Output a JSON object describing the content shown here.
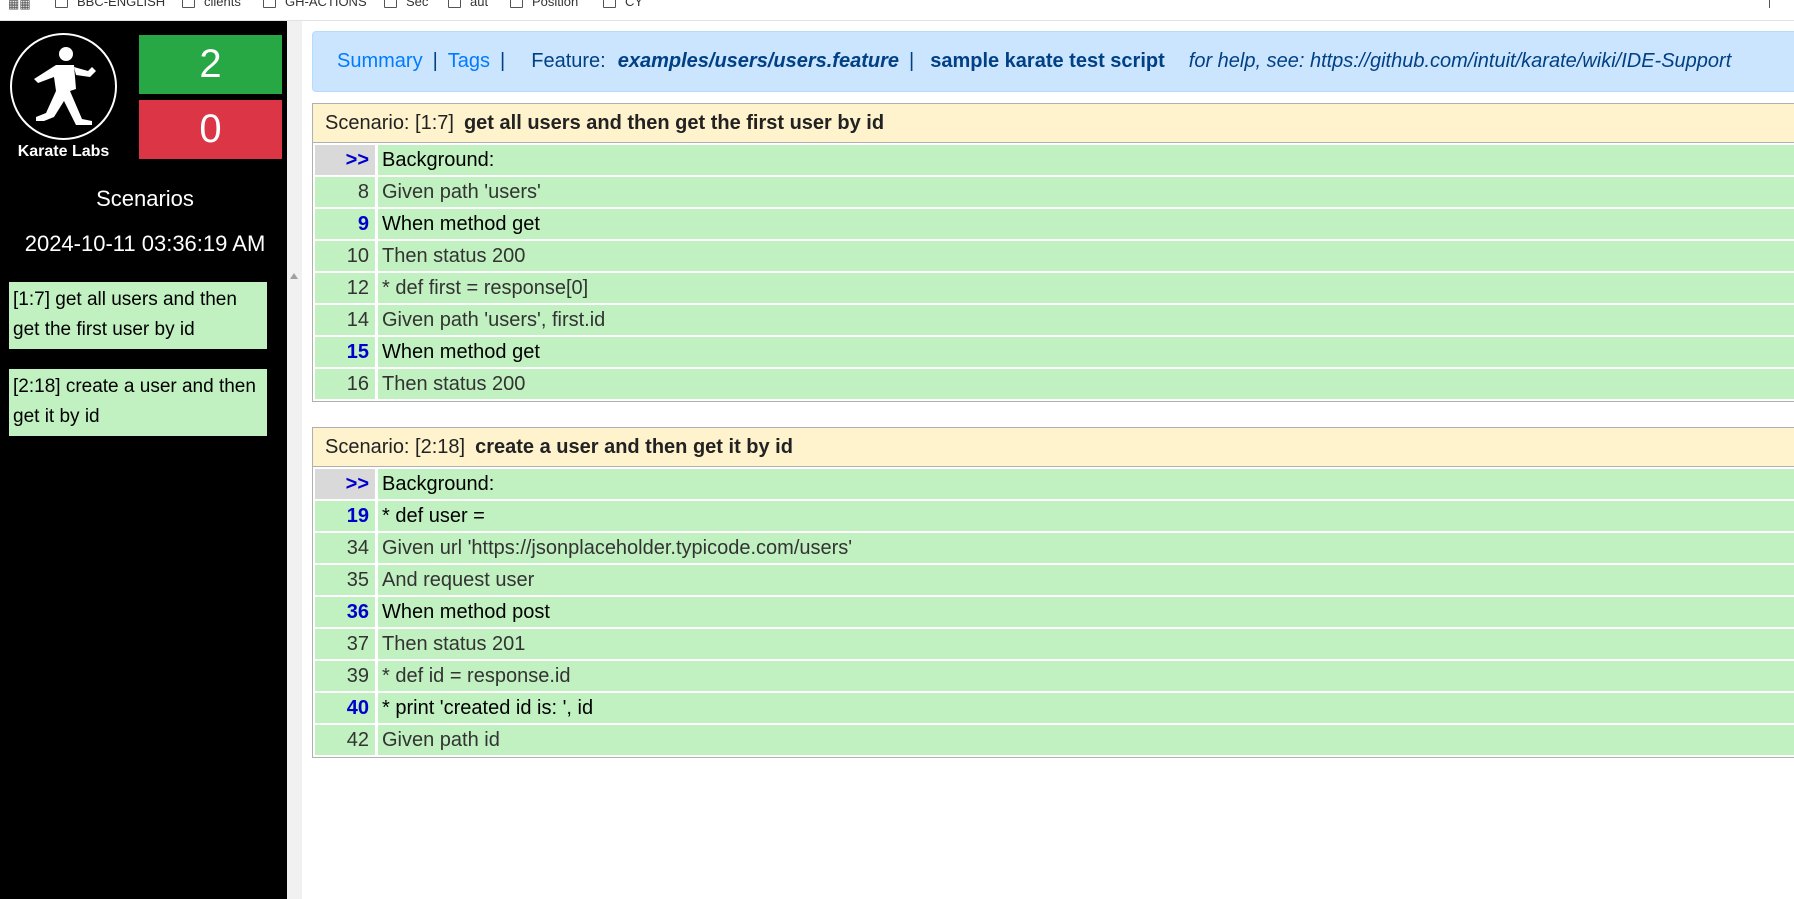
{
  "bookmarks": {
    "items": [
      "BBC-ENGLISH",
      "clients",
      "GH-ACTIONS",
      "Sec",
      "aut",
      "Position",
      "CY"
    ]
  },
  "sidebar": {
    "logo_text": "Karate Labs",
    "passed": "2",
    "failed": "0",
    "title": "Scenarios",
    "timestamp": "2024-10-11 03:36:19 AM",
    "scenarios": [
      "[1:7] get all users and then get the first user by id",
      "[2:18] create a user and then get it by id"
    ]
  },
  "header": {
    "summary": "Summary",
    "tags": "Tags",
    "sep": "|",
    "feature_label": "Feature:",
    "feature_path": "examples/users/users.feature",
    "feature_desc": "sample karate test script",
    "help": "for help, see: https://github.com/intuit/karate/wiki/IDE-Support"
  },
  "scenarios": [
    {
      "ref": "Scenario: [1:7]",
      "name": "get all users and then get the first user by id",
      "steps": [
        {
          "line": ">>",
          "text": "Background:",
          "kind": "bg"
        },
        {
          "line": "8",
          "text": "Given path 'users'",
          "kind": "plain"
        },
        {
          "line": "9",
          "text": "When method get",
          "kind": "bold"
        },
        {
          "line": "10",
          "text": "Then status 200",
          "kind": "plain"
        },
        {
          "line": "12",
          "text": "* def first = response[0]",
          "kind": "plain"
        },
        {
          "line": "14",
          "text": "Given path 'users', first.id",
          "kind": "plain"
        },
        {
          "line": "15",
          "text": "When method get",
          "kind": "bold"
        },
        {
          "line": "16",
          "text": "Then status 200",
          "kind": "plain"
        }
      ]
    },
    {
      "ref": "Scenario: [2:18]",
      "name": "create a user and then get it by id",
      "steps": [
        {
          "line": ">>",
          "text": "Background:",
          "kind": "bg"
        },
        {
          "line": "19",
          "text": "* def user =",
          "kind": "bold"
        },
        {
          "line": "34",
          "text": "Given url 'https://jsonplaceholder.typicode.com/users'",
          "kind": "plain"
        },
        {
          "line": "35",
          "text": "And request user",
          "kind": "plain"
        },
        {
          "line": "36",
          "text": "When method post",
          "kind": "bold"
        },
        {
          "line": "37",
          "text": "Then status 201",
          "kind": "plain"
        },
        {
          "line": "39",
          "text": "* def id = response.id",
          "kind": "plain"
        },
        {
          "line": "40",
          "text": "* print 'created id is: ', id",
          "kind": "bold"
        },
        {
          "line": "42",
          "text": "Given path id",
          "kind": "plain"
        }
      ]
    }
  ],
  "colors": {
    "pass": "#28a745",
    "fail": "#dc3545",
    "step_bg": "#c1f0c1",
    "scenario_head_bg": "#fff3cd",
    "header_bg": "#cce5ff"
  }
}
